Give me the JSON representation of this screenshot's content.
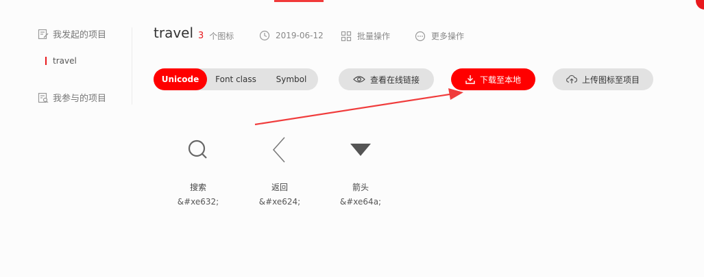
{
  "sidebar": {
    "my_projects": "我发起的项目",
    "current_project": "travel",
    "joined_projects": "我参与的项目"
  },
  "header": {
    "title": "travel",
    "icon_count": "3",
    "icon_count_suffix": "个图标",
    "date": "2019-06-12",
    "batch_ops": "批量操作",
    "more_ops": "更多操作"
  },
  "toolbar": {
    "tabs": [
      {
        "label": "Unicode",
        "active": true
      },
      {
        "label": "Font class",
        "active": false
      },
      {
        "label": "Symbol",
        "active": false
      }
    ],
    "view_link": "查看在线链接",
    "download": "下载至本地",
    "upload": "上传图标至项目"
  },
  "icons": [
    {
      "name": "搜索",
      "code": "&#xe632;",
      "icon": "search-icon"
    },
    {
      "name": "返回",
      "code": "&#xe624;",
      "icon": "back-icon"
    },
    {
      "name": "箭头",
      "code": "&#xe64a;",
      "icon": "arrow-down-icon"
    }
  ],
  "colors": {
    "accent": "#ff0000",
    "annotation": "#f03c3c",
    "button_gray": "#e2e2e2"
  }
}
